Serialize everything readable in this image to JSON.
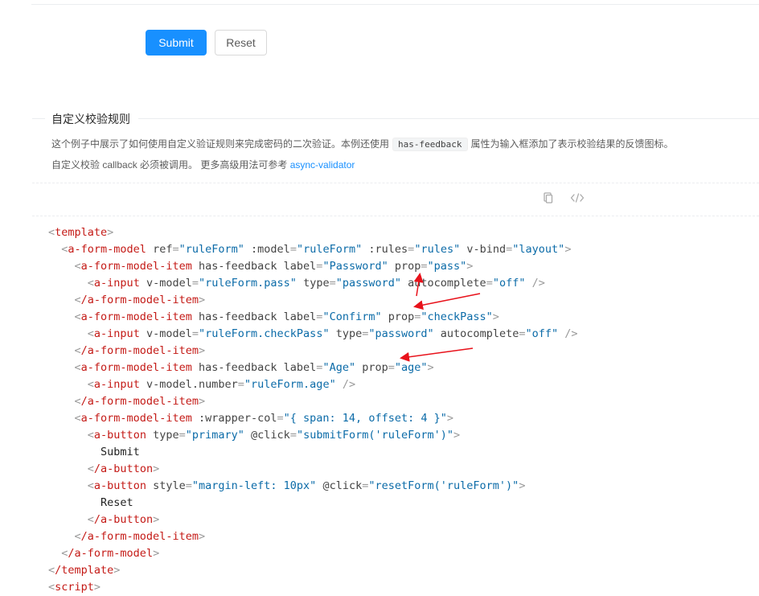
{
  "form_buttons": {
    "submit_label": "Submit",
    "reset_label": "Reset"
  },
  "section": {
    "title": "自定义校验规则",
    "desc_line1_before": "这个例子中展示了如何使用自定义验证规则来完成密码的二次验证。本例还使用",
    "desc_line1_code": "has-feedback",
    "desc_line1_after": "属性为输入框添加了表示校验结果的反馈图标。",
    "desc_line2_text": "自定义校验 callback 必须被调用。 更多高级用法可参考",
    "desc_line2_link": "async-validator"
  },
  "toolbar": {
    "copy_icon": "copy-icon",
    "code_icon": "code-expand-icon"
  },
  "code_lines": [
    "<template>",
    "  <a-form-model ref=\"ruleForm\" :model=\"ruleForm\" :rules=\"rules\" v-bind=\"layout\">",
    "    <a-form-model-item has-feedback label=\"Password\" prop=\"pass\">",
    "      <a-input v-model=\"ruleForm.pass\" type=\"password\" autocomplete=\"off\" />",
    "    </a-form-model-item>",
    "    <a-form-model-item has-feedback label=\"Confirm\" prop=\"checkPass\">",
    "      <a-input v-model=\"ruleForm.checkPass\" type=\"password\" autocomplete=\"off\" />",
    "    </a-form-model-item>",
    "    <a-form-model-item has-feedback label=\"Age\" prop=\"age\">",
    "      <a-input v-model.number=\"ruleForm.age\" />",
    "    </a-form-model-item>",
    "    <a-form-model-item :wrapper-col=\"{ span: 14, offset: 4 }\">",
    "      <a-button type=\"primary\" @click=\"submitForm('ruleForm')\">",
    "        Submit",
    "      </a-button>",
    "      <a-button style=\"margin-left: 10px\" @click=\"resetForm('ruleForm')\">",
    "        Reset",
    "      </a-button>",
    "    </a-form-model-item>",
    "  </a-form-model>",
    "</template>",
    "<script>"
  ],
  "colors": {
    "primary": "#1890ff",
    "tag": "#c41a16",
    "attr": "#444444",
    "value": "#0b6ba8",
    "annotation_arrow": "#e8121b"
  }
}
